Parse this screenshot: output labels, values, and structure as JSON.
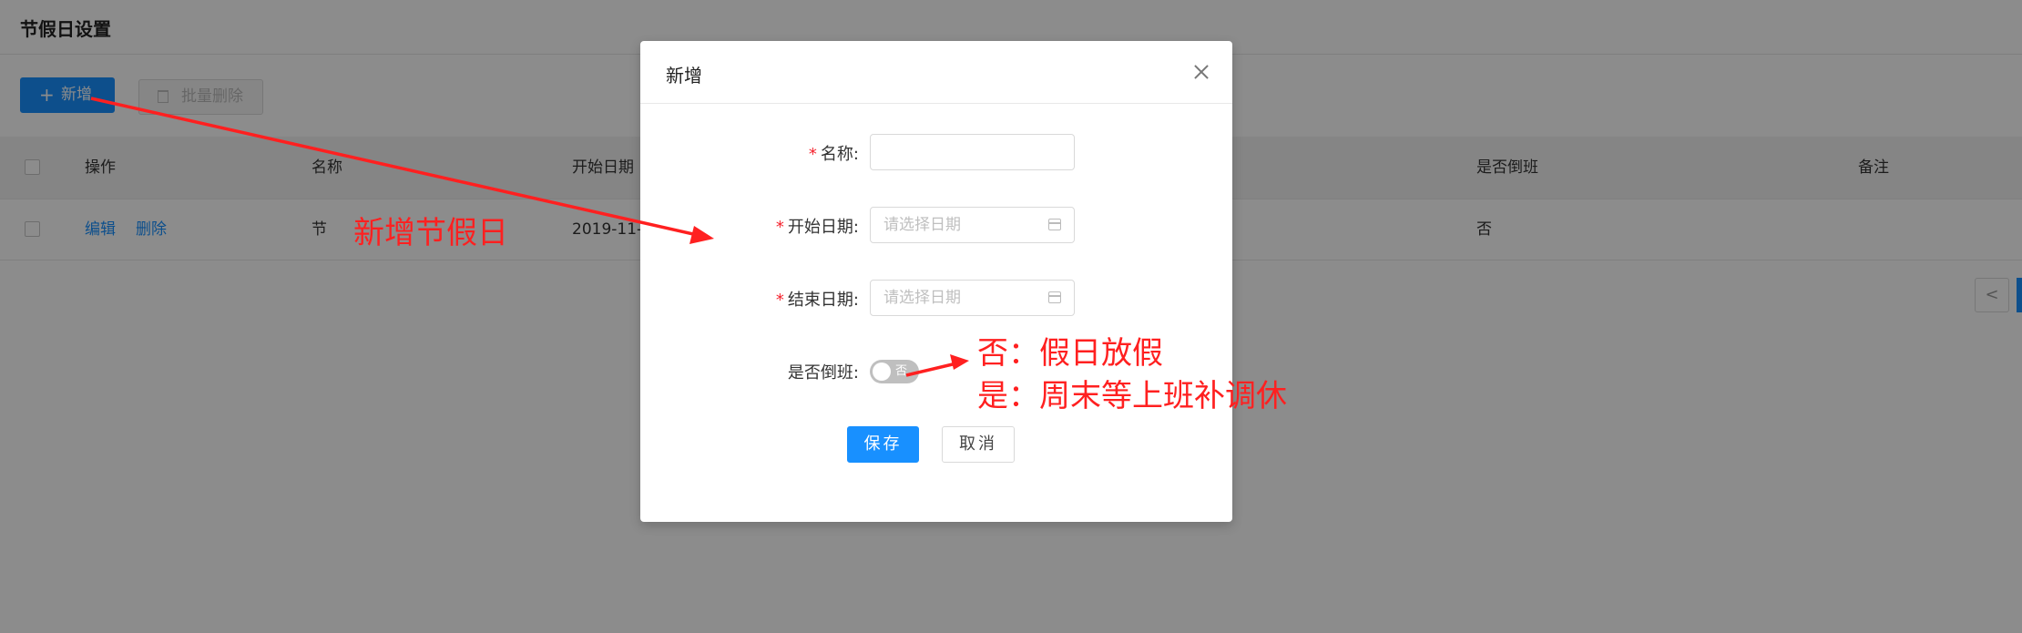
{
  "page": {
    "title": "节假日设置"
  },
  "toolbar": {
    "add_label": "新增",
    "batch_delete_label": "批量删除"
  },
  "table": {
    "columns": [
      "操作",
      "名称",
      "开始日期",
      "是否倒班",
      "备注"
    ],
    "rows": [
      {
        "action_edit": "编辑",
        "action_delete": "删除",
        "name": "节",
        "start_date": "2019-11-",
        "shift": "否",
        "remark": ""
      }
    ]
  },
  "pager": {
    "prev_symbol": "<"
  },
  "modal": {
    "title": "新增",
    "fields": {
      "name_label": "名称:",
      "start_label": "开始日期:",
      "end_label": "结束日期:",
      "shift_label": "是否倒班:",
      "date_placeholder": "请选择日期",
      "switch_text": "否",
      "switch_on": false
    },
    "save_label": "保存",
    "cancel_label": "取消"
  },
  "annotations": {
    "add_note": "新增节假日",
    "switch_note_line1": "否：假日放假",
    "switch_note_line2": "是：周末等上班补调休",
    "color": "#ff2020"
  },
  "colors": {
    "primary": "#1890ff",
    "required": "#f5222d"
  }
}
